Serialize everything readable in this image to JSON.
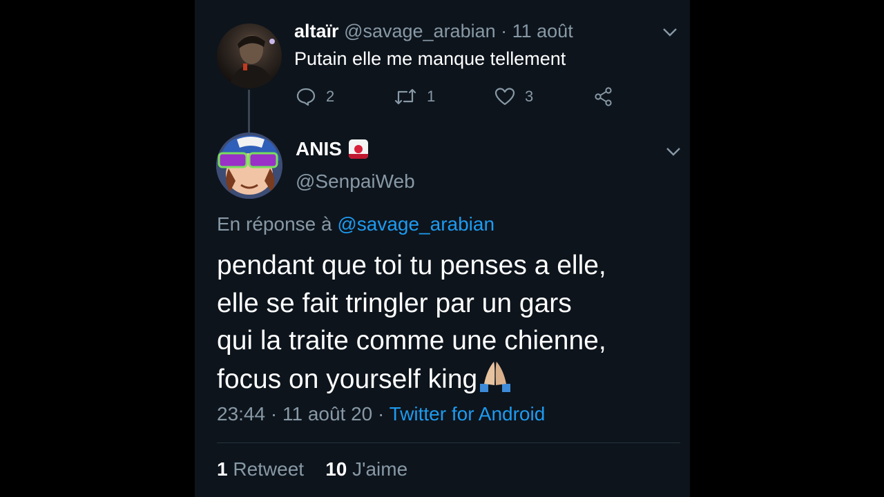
{
  "parent_tweet": {
    "name": "altaïr",
    "handle": "@savage_arabian",
    "separator": " · ",
    "date": "11 août",
    "text": "Putain elle me manque tellement",
    "reply_count": "2",
    "retweet_count": "1",
    "like_count": "3"
  },
  "main_tweet": {
    "name": "ANIS",
    "handle": "@SenpaiWeb",
    "reply_prefix": "En réponse à ",
    "reply_handle": "@savage_arabian",
    "lines": [
      "pendant que toi tu penses a elle,",
      "elle se fait tringler par un gars",
      "qui la traite comme une chienne,",
      "focus on yourself king"
    ],
    "time": "23:44",
    "date": "11 août 20",
    "separator": " · ",
    "client": "Twitter for Android",
    "retweets_count": "1",
    "retweets_label": "Retweet",
    "likes_count": "10",
    "likes_label": "J'aime"
  },
  "colors": {
    "background": "#0d141c",
    "secondary_text": "#8899a6",
    "link": "#1d9bf0"
  },
  "icons": [
    "chevron-down-icon",
    "reply-icon",
    "retweet-icon",
    "heart-icon",
    "share-icon",
    "folded-hands-emoji",
    "badge-emoji"
  ]
}
